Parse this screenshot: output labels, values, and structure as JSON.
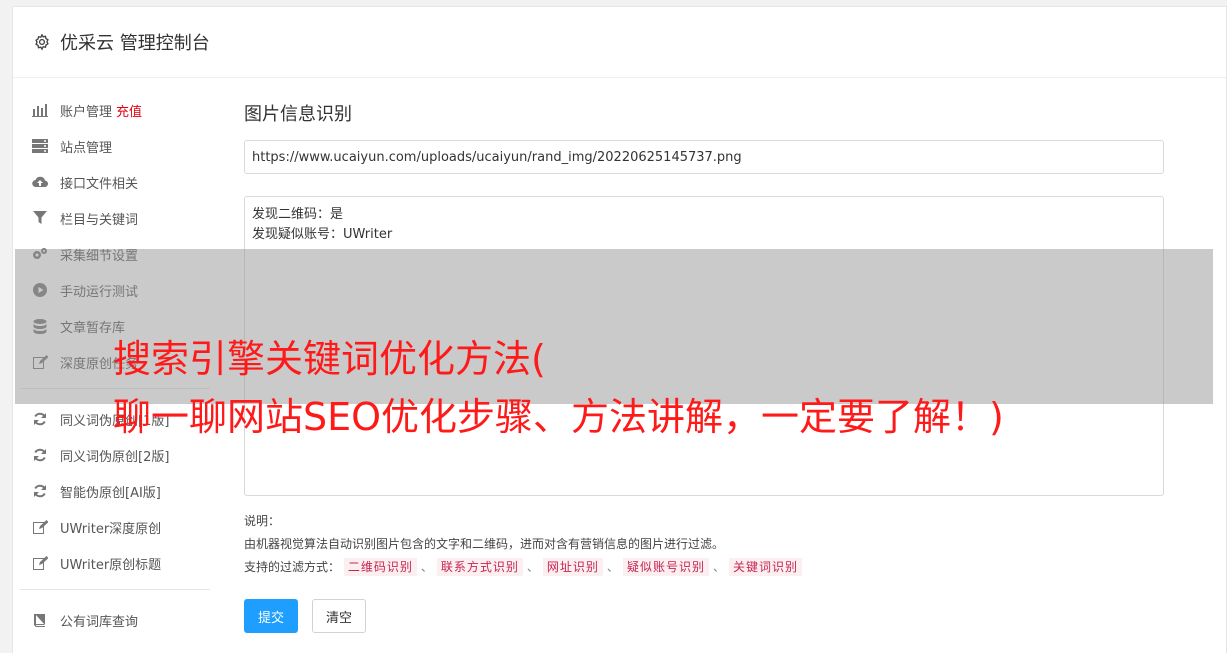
{
  "header": {
    "title": "优采云 管理控制台",
    "icon": "gear-icon"
  },
  "sidebar": {
    "group1": [
      {
        "label": "账户管理",
        "badge": "充值",
        "icon": "bar-chart-icon"
      },
      {
        "label": "站点管理",
        "icon": "server-icon"
      },
      {
        "label": "接口文件相关",
        "icon": "cloud-upload-icon"
      },
      {
        "label": "栏目与关键词",
        "icon": "filter-icon"
      },
      {
        "label": "采集细节设置",
        "icon": "gears-icon"
      },
      {
        "label": "手动运行测试",
        "icon": "play-icon"
      },
      {
        "label": "文章暂存库",
        "icon": "database-icon"
      },
      {
        "label": "深度原创任务",
        "icon": "edit-icon"
      }
    ],
    "group2": [
      {
        "label": "同义词伪原创[1版]",
        "icon": "refresh-icon"
      },
      {
        "label": "同义词伪原创[2版]",
        "icon": "refresh-icon"
      },
      {
        "label": "智能伪原创[AI版]",
        "icon": "refresh-icon"
      },
      {
        "label": "UWriter深度原创",
        "icon": "edit-icon"
      },
      {
        "label": "UWriter原创标题",
        "icon": "edit-icon"
      }
    ],
    "group3": [
      {
        "label": "公有词库查询",
        "icon": "book-icon"
      }
    ]
  },
  "main": {
    "title": "图片信息识别",
    "url_value": "https://www.ucaiyun.com/uploads/ucaiyun/rand_img/20220625145737.png",
    "result_lines": [
      "发现二维码：是",
      "发现疑似账号：UWriter"
    ],
    "desc_label": "说明：",
    "desc_text": "由机器视觉算法自动识别图片包含的文字和二维码，进而对含有营销信息的图片进行过滤。",
    "filter_label": "支持的过滤方式：",
    "filter_tags": [
      "二维码识别",
      "联系方式识别",
      "网址识别",
      "疑似账号识别",
      "关键词识别"
    ],
    "filter_sep": "、",
    "submit_label": "提交",
    "clear_label": "清空"
  },
  "overlay": {
    "line1": "搜索引擎关键词优化方法(",
    "line2": "聊一聊网站SEO优化步骤、方法讲解，一定要了解！)"
  },
  "colors": {
    "accent": "#1e9fff",
    "hot": "#e60012",
    "headline": "#ff1a1a",
    "tag_text": "#c7254e",
    "tag_bg": "#fbeff2"
  }
}
